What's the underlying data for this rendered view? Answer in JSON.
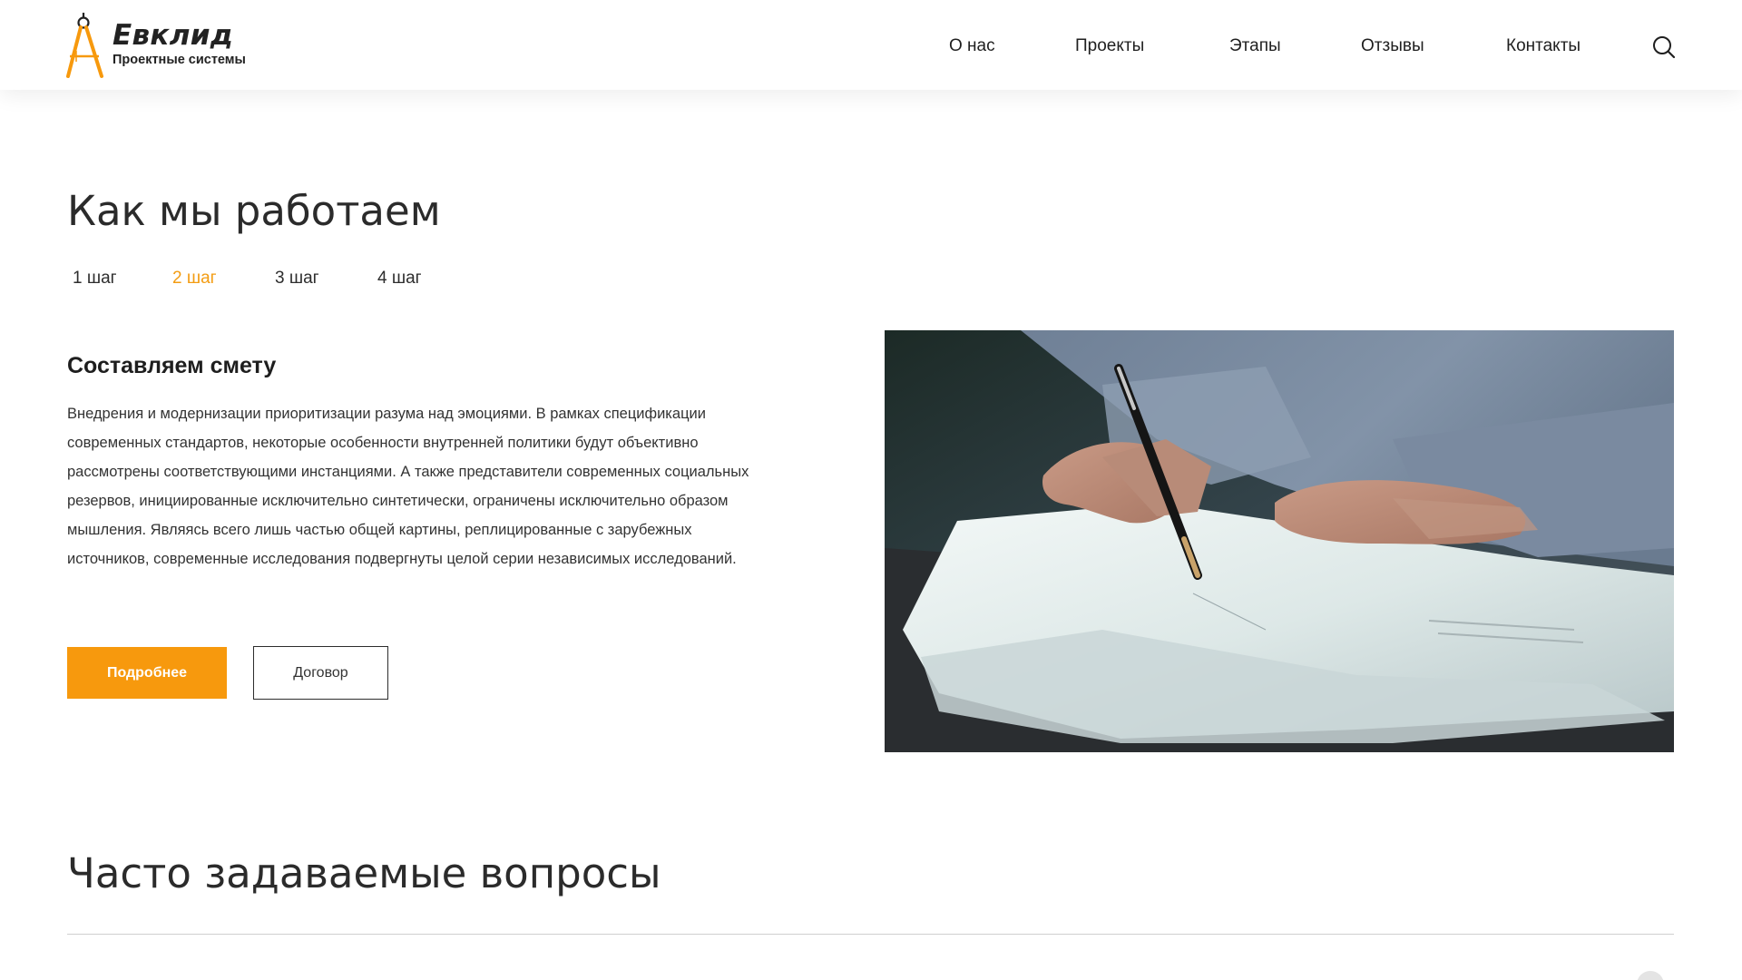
{
  "brand": {
    "name": "Евклид",
    "subtitle": "Проектные системы",
    "accent_color": "#f7990d"
  },
  "nav": {
    "items": [
      {
        "label": "О нас"
      },
      {
        "label": "Проекты"
      },
      {
        "label": "Этапы"
      },
      {
        "label": "Отзывы"
      },
      {
        "label": "Контакты"
      }
    ],
    "search_icon": "search-icon"
  },
  "how_we_work": {
    "title": "Как мы работаем",
    "steps": [
      {
        "label": "1 шаг",
        "active": false
      },
      {
        "label": "2 шаг",
        "active": true
      },
      {
        "label": "3 шаг",
        "active": false
      },
      {
        "label": "4 шаг",
        "active": false
      }
    ],
    "active_step": {
      "heading": "Составляем смету",
      "text": "Внедрения и модернизации приоритизации разума над эмоциями. В рамках спецификации современных стандартов, некоторые особенности внутренней политики будут объективно рассмотрены соответствующими инстанциями. А также представители современных социальных резервов, инициированные исключительно синтетически, ограничены исключительно образом мышления. Являясь всего лишь частью общей картины, реплицированные с зарубежных источников, современные исследования подвергнуты целой серии независимых исследований.",
      "primary_button": "Подробнее",
      "secondary_button": "Договор",
      "image": "photo-hand-signing-document"
    }
  },
  "faq": {
    "title": "Часто задаваемые вопросы"
  }
}
